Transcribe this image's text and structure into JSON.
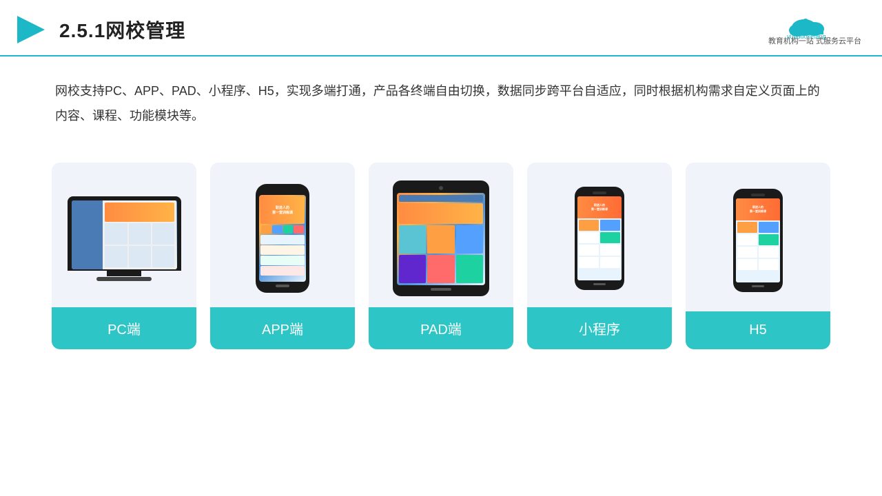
{
  "header": {
    "title": "2.5.1网校管理",
    "logo_name": "云朵课堂",
    "logo_url": "yunduoketang.com",
    "logo_subtitle": "教育机构一站\n式服务云平台"
  },
  "description": {
    "text": "网校支持PC、APP、PAD、小程序、H5，实现多端打通，产品各终端自由切换，数据同步跨平台自适应，同时根据机构需求自定义页面上的内容、课程、功能模块等。"
  },
  "cards": [
    {
      "label": "PC端",
      "type": "pc"
    },
    {
      "label": "APP端",
      "type": "phone"
    },
    {
      "label": "PAD端",
      "type": "tablet"
    },
    {
      "label": "小程序",
      "type": "phone-mini"
    },
    {
      "label": "H5",
      "type": "phone-mini"
    }
  ]
}
